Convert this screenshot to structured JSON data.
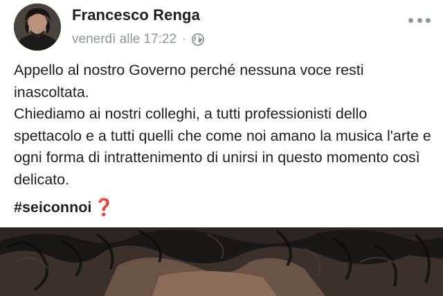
{
  "post": {
    "author": "Francesco Renga",
    "timestamp": "venerdì alle 17:22",
    "separator": "·",
    "privacy_icon": "globe-icon",
    "more_icon": "more-options-icon",
    "body_lines": [
      "Appello al nostro Governo perché nessuna voce resti inascoltata.",
      "Chiediamo ai nostri colleghi, a tutti professionisti dello spettacolo e a tutti quelli che come noi amano la musica l'arte e ogni forma di intrattenimento di unirsi in questo momento così delicato."
    ],
    "hashtag": "#seiconnoi",
    "hashtag_emoji": "❓"
  },
  "colors": {
    "text": "#1c1e21",
    "meta": "#90949c",
    "emoji_red": "#e0242a"
  }
}
